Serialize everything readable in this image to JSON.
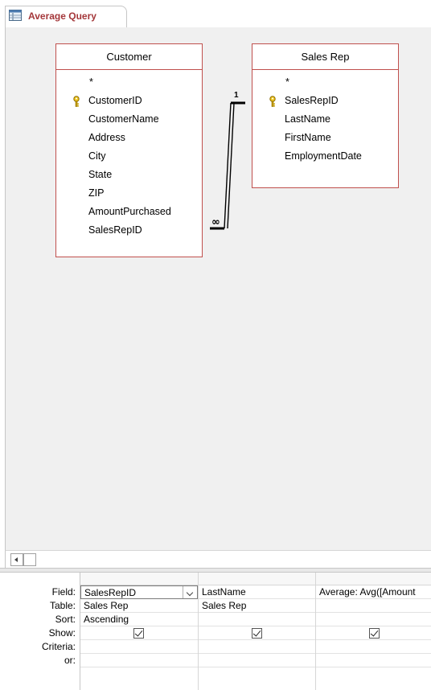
{
  "tab": {
    "title": "Average Query",
    "icon": "query-icon"
  },
  "tables": [
    {
      "name": "Customer",
      "fields": [
        "*",
        "CustomerID",
        "CustomerName",
        "Address",
        "City",
        "State",
        "ZIP",
        "AmountPurchased",
        "SalesRepID"
      ],
      "key_field": "CustomerID"
    },
    {
      "name": "Sales Rep",
      "fields": [
        "*",
        "SalesRepID",
        "LastName",
        "FirstName",
        "EmploymentDate"
      ],
      "key_field": "SalesRepID"
    }
  ],
  "relationship": {
    "one_label": "1",
    "many_label": "∞"
  },
  "grid": {
    "row_labels": [
      "Field:",
      "Table:",
      "Sort:",
      "Show:",
      "Criteria:",
      "or:"
    ],
    "columns": [
      {
        "field": "SalesRepID",
        "table": "Sales Rep",
        "sort": "Ascending",
        "show": true
      },
      {
        "field": "LastName",
        "table": "Sales Rep",
        "sort": "",
        "show": true
      },
      {
        "field": "Average: Avg([Amount",
        "table": "",
        "sort": "",
        "show": true
      }
    ]
  },
  "colors": {
    "table_border": "#c0504d",
    "tab_text": "#a4373a"
  }
}
